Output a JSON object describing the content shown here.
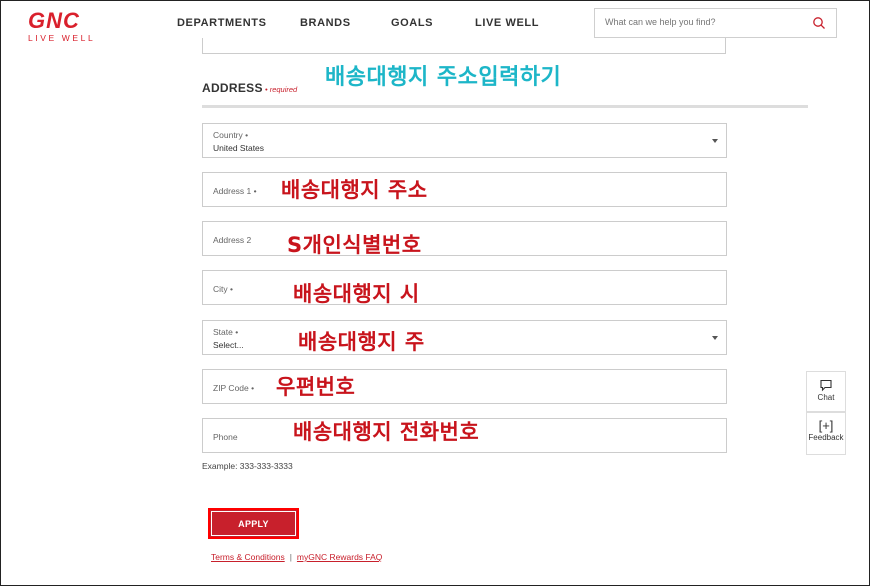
{
  "brand": {
    "name": "GNC",
    "tagline": "LIVE WELL",
    "color": "#d9202c"
  },
  "nav": {
    "items": [
      "DEPARTMENTS",
      "BRANDS",
      "GOALS",
      "LIVE WELL"
    ]
  },
  "search": {
    "placeholder": "What can we help you find?"
  },
  "annotations": {
    "title": "배송대행지 주소입력하기",
    "address1": "배송대행지 주소",
    "address2": "S개인식별번호",
    "city": "배송대행지 시",
    "state": "배송대행지 주",
    "zip": "우편번호",
    "phone": "배송대행지 전화번호"
  },
  "address": {
    "title": "ADDRESS",
    "required": "• required",
    "country": {
      "label": "Country •",
      "value": "United States"
    },
    "address1": {
      "label": "Address 1 •"
    },
    "address2": {
      "label": "Address 2"
    },
    "city": {
      "label": "City •"
    },
    "state": {
      "label": "State •",
      "value": "Select..."
    },
    "zip": {
      "label": "ZIP Code •"
    },
    "phone": {
      "label": "Phone"
    },
    "example": "Example: 333-333-3333"
  },
  "apply_label": "APPLY",
  "links": {
    "terms": "Terms & Conditions",
    "sep": "|",
    "faq": "myGNC Rewards FAQ"
  },
  "side": {
    "chat": "Chat",
    "feedback_icon": "[+]",
    "feedback": "Feedback"
  }
}
